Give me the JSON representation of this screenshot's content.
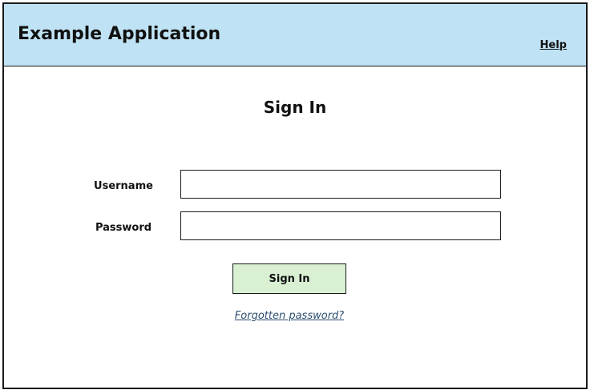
{
  "header": {
    "app_title": "Example Application",
    "help_label": "Help",
    "background_color": "#bfe3f4"
  },
  "signin_form": {
    "title": "Sign In",
    "username": {
      "label": "Username",
      "value": "",
      "placeholder": ""
    },
    "password": {
      "label": "Password",
      "value": "",
      "placeholder": ""
    },
    "submit_label": "Sign In",
    "submit_color": "#d9f0d3",
    "forgot_password_label": "Forgotten password?"
  }
}
